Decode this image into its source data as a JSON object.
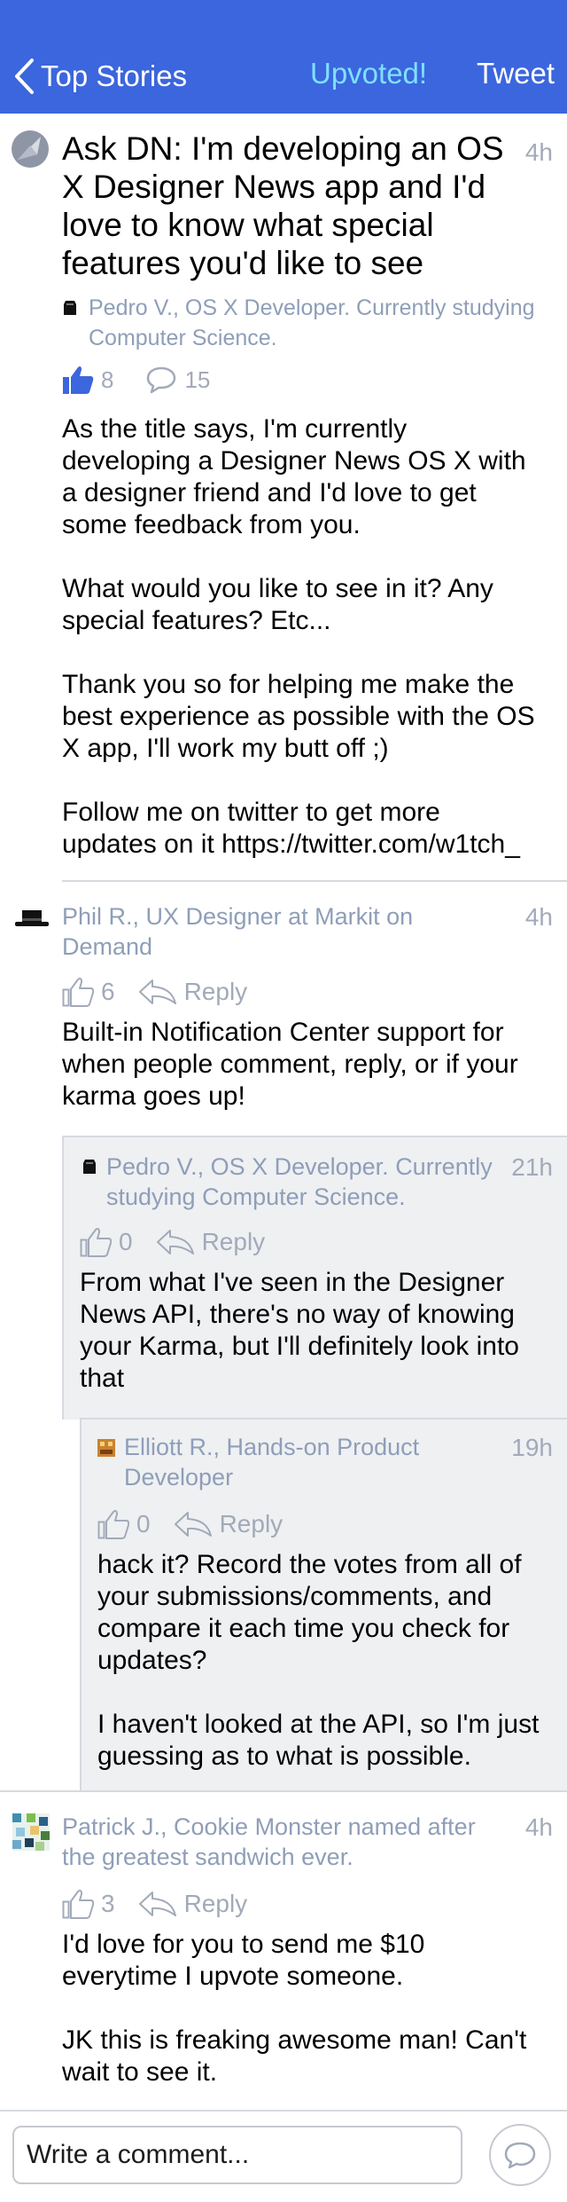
{
  "nav": {
    "back_label": "Top Stories",
    "upvoted_label": "Upvoted!",
    "tweet_label": "Tweet"
  },
  "story": {
    "title": "Ask DN: I'm developing an OS X Designer News app and I'd love to know what special features you'd like to see",
    "time": "4h",
    "author": "Pedro V., OS X Developer. Currently studying Computer Science.",
    "upvotes": "8",
    "comments": "15",
    "body": "As the title says, I'm currently developing a Designer News OS X with a designer friend and I'd love to get some feedback from you.\n\nWhat would you like to see in it? Any special features? Etc...\n\nThank you so for helping me make the best experience as possible with the OS X app, I'll work my butt off ;)\n\nFollow me on twitter to get more updates on it https://twitter.com/w1tch_"
  },
  "comments": [
    {
      "author": "Phil R., UX Designer at Markit on Demand",
      "time": "4h",
      "upvotes": "6",
      "reply_label": "Reply",
      "body": "Built-in Notification Center support for when people comment, reply, or if your karma goes up!"
    },
    {
      "author": "Pedro V., OS X Developer. Currently studying Computer Science.",
      "time": "21h",
      "upvotes": "0",
      "reply_label": "Reply",
      "body": "From what I've seen in the Designer News API, there's no way of knowing your Karma, but I'll definitely look into that"
    },
    {
      "author": "Elliott R., Hands-on Product Developer",
      "time": "19h",
      "upvotes": "0",
      "reply_label": "Reply",
      "body": "hack it? Record the votes from all of your submissions/comments, and compare it each time you check for updates?\n\nI haven't looked at the API, so I'm just guessing as to what is possible."
    },
    {
      "author": "Patrick J., Cookie Monster named after the greatest sandwich ever.",
      "time": "4h",
      "upvotes": "3",
      "reply_label": "Reply",
      "body": "I'd love for you to send me $10 everytime I upvote someone.\n\nJK this is freaking awesome man! Can't wait to see it."
    }
  ],
  "composer": {
    "placeholder": "Write a comment..."
  },
  "colors": {
    "nav_bg": "#3c66dd",
    "upvoted": "#7ee0ff",
    "meta": "#8f9eb8",
    "accent": "#3c66dd"
  },
  "icons": {
    "back": "chevron-left-icon",
    "story": "sketch-icon",
    "upvote": "thumbs-up-icon",
    "comment": "speech-bubble-icon",
    "reply": "reply-arrow-icon",
    "send": "send-bubble-icon"
  }
}
